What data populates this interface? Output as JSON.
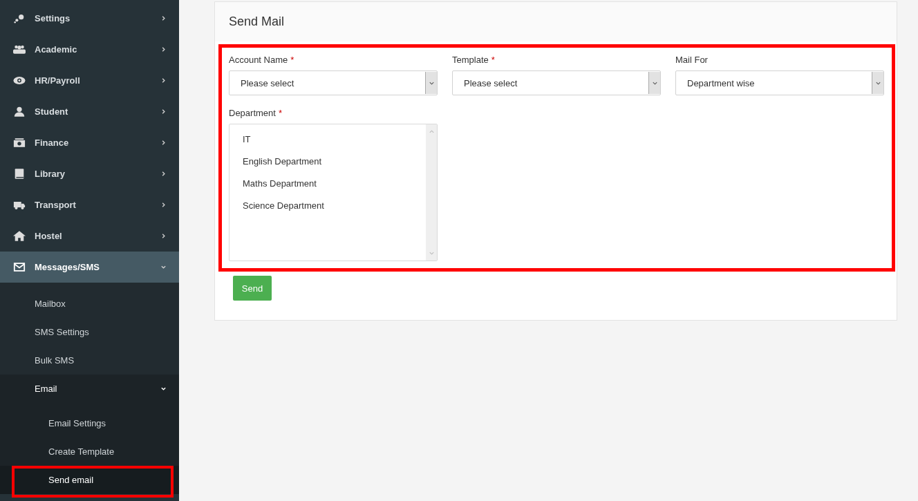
{
  "sidebar": {
    "items": [
      {
        "label": "Settings",
        "expanded": false
      },
      {
        "label": "Academic",
        "expanded": false
      },
      {
        "label": "HR/Payroll",
        "expanded": false
      },
      {
        "label": "Student",
        "expanded": false
      },
      {
        "label": "Finance",
        "expanded": false
      },
      {
        "label": "Library",
        "expanded": false
      },
      {
        "label": "Transport",
        "expanded": false
      },
      {
        "label": "Hostel",
        "expanded": false
      },
      {
        "label": "Messages/SMS",
        "expanded": true,
        "children": [
          {
            "label": "Mailbox",
            "selected": false
          },
          {
            "label": "SMS Settings",
            "selected": false
          },
          {
            "label": "Bulk SMS",
            "selected": false
          },
          {
            "label": "Email",
            "expanded": true,
            "children": [
              {
                "label": "Email Settings",
                "selected": false
              },
              {
                "label": "Create Template",
                "selected": false
              },
              {
                "label": "Send email",
                "selected": true
              }
            ]
          }
        ]
      }
    ]
  },
  "panel": {
    "title": "Send Mail",
    "fields": [
      {
        "label": "Account Name",
        "required_mark": "*",
        "value": "Please select"
      },
      {
        "label": "Template",
        "required_mark": "*",
        "value": "Please select"
      },
      {
        "label": "Mail For",
        "value": "Department wise"
      }
    ],
    "department": {
      "label": "Department",
      "required_mark": "*",
      "options": [
        {
          "label": "IT",
          "selected": false
        },
        {
          "label": "English Department",
          "selected": false
        },
        {
          "label": "Maths Department",
          "selected": false
        },
        {
          "label": "Science Department",
          "selected": false
        }
      ]
    },
    "send_button": "Send"
  }
}
